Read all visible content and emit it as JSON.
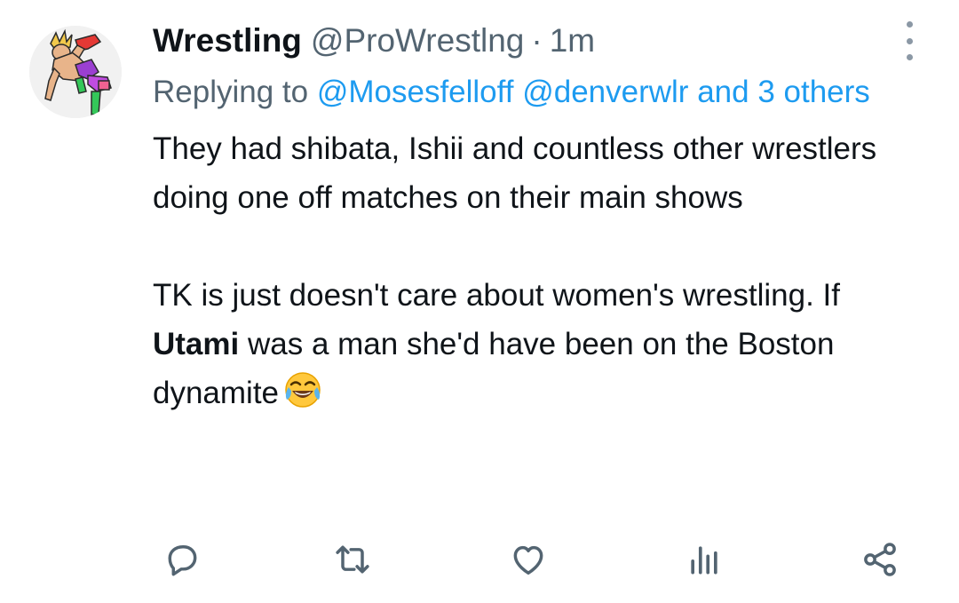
{
  "tweet": {
    "author": {
      "display_name": "Wrestling",
      "handle": "@ProWrestlng",
      "separator": "·",
      "time": "1m"
    },
    "reply": {
      "prefix": "Replying to ",
      "mentions": [
        "@Mosesfelloff",
        "@denverwlr",
        "and 3 others"
      ]
    },
    "body": {
      "paragraph_1": "They had shibata, Ishii and countless other wrestlers doing one off matches on their main shows",
      "paragraph_2_before": "TK is just doesn't care about women's wrestling. If ",
      "paragraph_2_bold": "Utami",
      "paragraph_2_after": " was a man she'd have been on the Boston dynamite",
      "emoji": "face-with-tears-of-joy"
    },
    "actions": [
      "reply-icon",
      "retweet-icon",
      "like-icon",
      "views-icon",
      "share-icon"
    ],
    "colors": {
      "link": "#1d9bf0",
      "secondary_text": "#536471",
      "icon": "#536471"
    }
  }
}
